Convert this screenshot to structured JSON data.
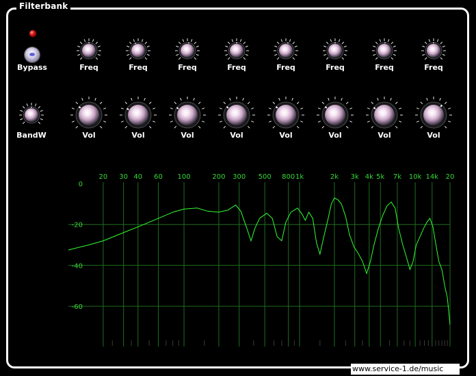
{
  "window": {
    "title": "Filterbank"
  },
  "bypass": {
    "label": "Bypass"
  },
  "bandwidth": {
    "label": "BandW"
  },
  "bands": [
    {
      "freq_label": "Freq",
      "vol_label": "Vol"
    },
    {
      "freq_label": "Freq",
      "vol_label": "Vol"
    },
    {
      "freq_label": "Freq",
      "vol_label": "Vol"
    },
    {
      "freq_label": "Freq",
      "vol_label": "Vol"
    },
    {
      "freq_label": "Freq",
      "vol_label": "Vol"
    },
    {
      "freq_label": "Freq",
      "vol_label": "Vol"
    },
    {
      "freq_label": "Freq",
      "vol_label": "Vol"
    },
    {
      "freq_label": "Freq",
      "vol_label": "Vol"
    }
  ],
  "analyzer": {
    "freq_ticks": [
      {
        "hz": 20,
        "label": "20"
      },
      {
        "hz": 30,
        "label": "30"
      },
      {
        "hz": 40,
        "label": "40"
      },
      {
        "hz": 60,
        "label": "60"
      },
      {
        "hz": 100,
        "label": "100"
      },
      {
        "hz": 200,
        "label": "200"
      },
      {
        "hz": 300,
        "label": "300"
      },
      {
        "hz": 500,
        "label": "500"
      },
      {
        "hz": 800,
        "label": "800"
      },
      {
        "hz": 1000,
        "label": "1k"
      },
      {
        "hz": 2000,
        "label": "2k"
      },
      {
        "hz": 3000,
        "label": "3k"
      },
      {
        "hz": 4000,
        "label": "4k"
      },
      {
        "hz": 5000,
        "label": "5k"
      },
      {
        "hz": 7000,
        "label": "7k"
      },
      {
        "hz": 10000,
        "label": "10k"
      },
      {
        "hz": 14000,
        "label": "14k"
      },
      {
        "hz": 20000,
        "label": "20"
      }
    ],
    "db_ticks": [
      {
        "db": 0,
        "label": "0"
      },
      {
        "db": -20,
        "label": "-20"
      },
      {
        "db": -40,
        "label": "-40"
      },
      {
        "db": -60,
        "label": "-60"
      }
    ],
    "freq_range": [
      10,
      20000
    ],
    "db_range": [
      -70,
      0
    ],
    "colors": {
      "grid": "#1f6e1f",
      "curve": "#33ff33",
      "label": "#36d836"
    },
    "response": [
      [
        10,
        -32.5
      ],
      [
        15,
        -30
      ],
      [
        20,
        -28
      ],
      [
        30,
        -24
      ],
      [
        45,
        -20
      ],
      [
        60,
        -17
      ],
      [
        80,
        -14
      ],
      [
        100,
        -12.5
      ],
      [
        130,
        -12
      ],
      [
        160,
        -13.5
      ],
      [
        200,
        -14
      ],
      [
        240,
        -13
      ],
      [
        280,
        -10.5
      ],
      [
        310,
        -13.5
      ],
      [
        350,
        -22
      ],
      [
        380,
        -28
      ],
      [
        410,
        -22
      ],
      [
        450,
        -17
      ],
      [
        520,
        -14.5
      ],
      [
        580,
        -17
      ],
      [
        640,
        -26
      ],
      [
        700,
        -28
      ],
      [
        760,
        -19
      ],
      [
        840,
        -14
      ],
      [
        900,
        -13
      ],
      [
        960,
        -12
      ],
      [
        1050,
        -15
      ],
      [
        1120,
        -18
      ],
      [
        1200,
        -14
      ],
      [
        1300,
        -17
      ],
      [
        1400,
        -29
      ],
      [
        1500,
        -34.5
      ],
      [
        1620,
        -26
      ],
      [
        1750,
        -18
      ],
      [
        1880,
        -10
      ],
      [
        2000,
        -7
      ],
      [
        2150,
        -8
      ],
      [
        2300,
        -10
      ],
      [
        2500,
        -16
      ],
      [
        2700,
        -25
      ],
      [
        2950,
        -31
      ],
      [
        3200,
        -34
      ],
      [
        3500,
        -38
      ],
      [
        3800,
        -44
      ],
      [
        4100,
        -38
      ],
      [
        4400,
        -30
      ],
      [
        4800,
        -22
      ],
      [
        5200,
        -16
      ],
      [
        5700,
        -11
      ],
      [
        6200,
        -9
      ],
      [
        6700,
        -12
      ],
      [
        7200,
        -22
      ],
      [
        7800,
        -30
      ],
      [
        8400,
        -36
      ],
      [
        9000,
        -42
      ],
      [
        9600,
        -38
      ],
      [
        10200,
        -30
      ],
      [
        11000,
        -26
      ],
      [
        11800,
        -22
      ],
      [
        12600,
        -19
      ],
      [
        13400,
        -17
      ],
      [
        14200,
        -21
      ],
      [
        15000,
        -29
      ],
      [
        16000,
        -38
      ],
      [
        17000,
        -42
      ],
      [
        18000,
        -50
      ],
      [
        19000,
        -56
      ],
      [
        20000,
        -69
      ]
    ]
  },
  "footer": {
    "url": "www.service-1.de/music"
  }
}
